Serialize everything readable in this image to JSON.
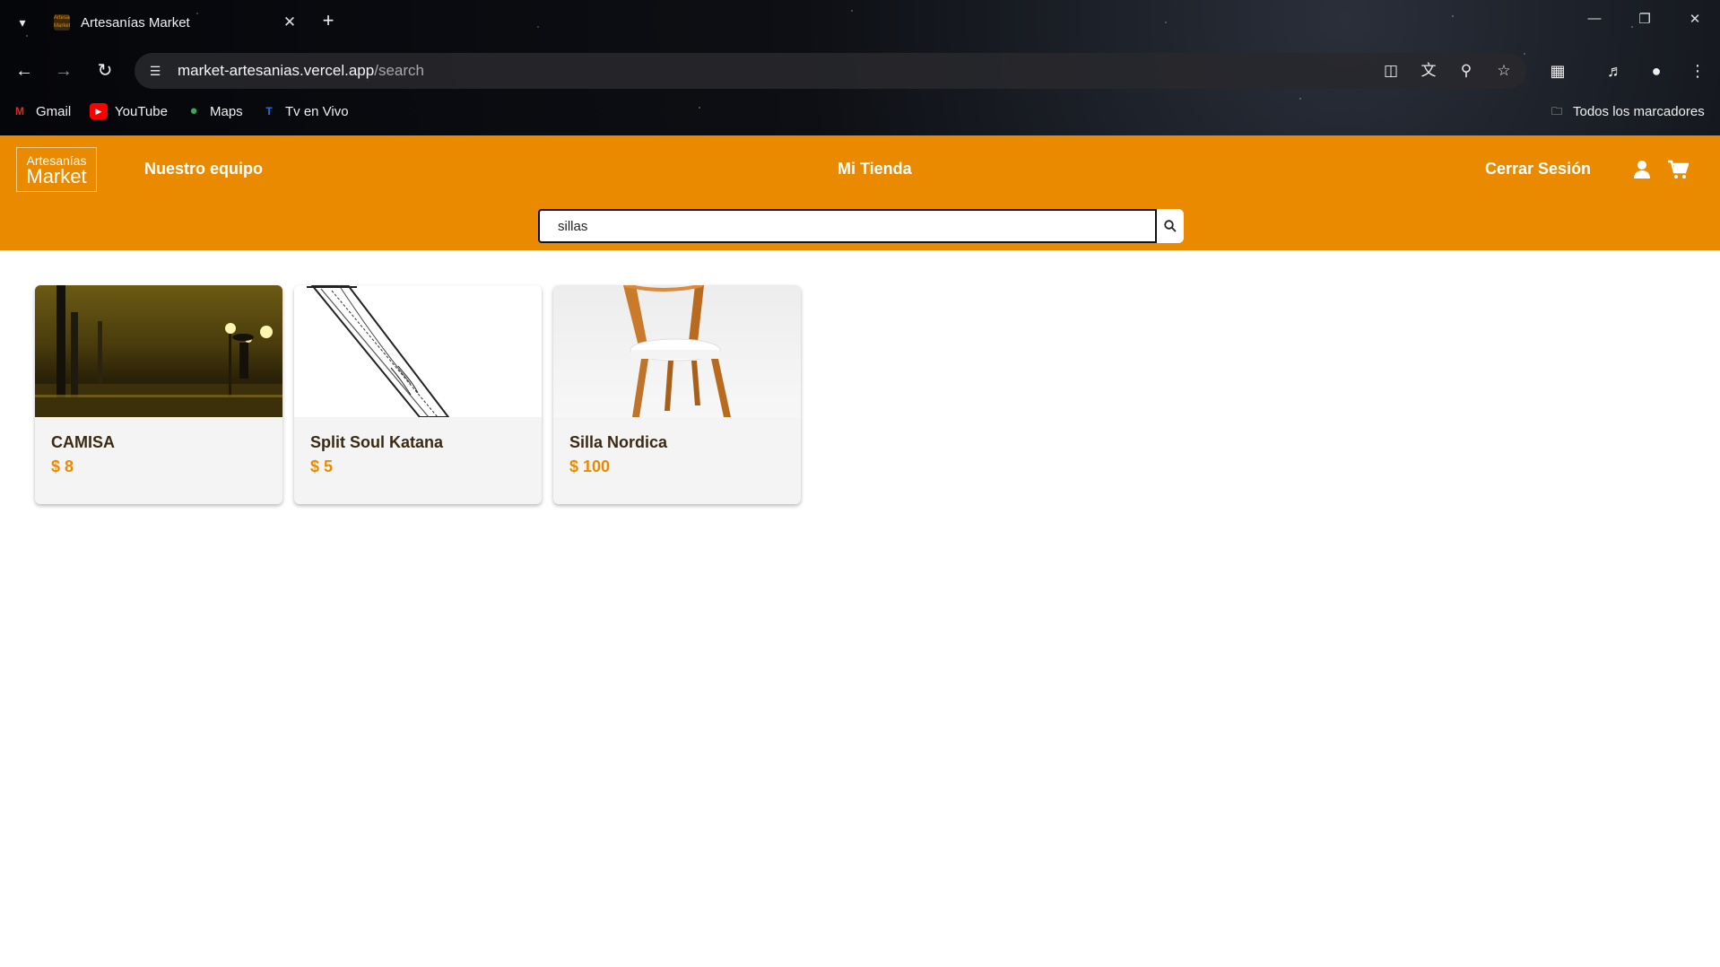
{
  "browser": {
    "tab_title": "Artesanías Market",
    "tab_favicon_text": "Artesanías Market",
    "url_host": "market-artesanias.vercel.app",
    "url_path": "/search",
    "bookmarks": [
      {
        "label": "Gmail",
        "icon": "gmail-icon",
        "color": "#d93025"
      },
      {
        "label": "YouTube",
        "icon": "youtube-icon",
        "color": "#ff0000"
      },
      {
        "label": "Maps",
        "icon": "maps-icon",
        "color": "#34a853"
      },
      {
        "label": "Tv en Vivo",
        "icon": "tv-icon",
        "color": "#1a73e8"
      }
    ],
    "all_bookmarks_label": "Todos los marcadores"
  },
  "header": {
    "logo_line1": "Artesanías",
    "logo_line2": "Market",
    "nav_team": "Nuestro equipo",
    "nav_store": "Mi Tienda",
    "nav_logout": "Cerrar Sesión",
    "search_value": "sillas",
    "accent_color": "#e98a00"
  },
  "products": [
    {
      "name": "CAMISA",
      "price": "$ 8"
    },
    {
      "name": "Split Soul Katana",
      "price": "$ 5"
    },
    {
      "name": "Silla Nordica",
      "price": "$ 100"
    }
  ]
}
